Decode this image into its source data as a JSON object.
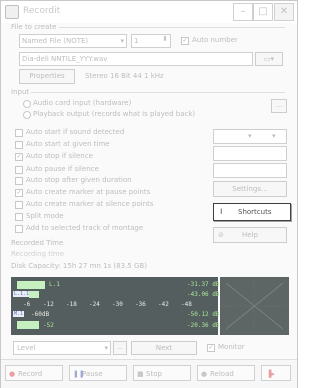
{
  "window": {
    "title": "Recordit",
    "minimize": "–",
    "maximize": "□",
    "close": "✕"
  },
  "file_to_create": {
    "heading": "File to create",
    "name_mode": "Named File (NOTE)",
    "number_value": "1",
    "auto_number_label": "Auto number",
    "auto_number_checked": true,
    "path": "Dia-dell NNTILE_YYY.wav",
    "properties_label": "Properties",
    "format_text": "Stereo 16 Bit 44 1 kHz"
  },
  "input": {
    "heading": "Input",
    "option1": "Audio card input (hardware)",
    "option2": "Playback output (records what is played back)",
    "selected": 1,
    "more_button": "..."
  },
  "options": [
    {
      "label": "Auto start if sound detected",
      "checked": false
    },
    {
      "label": "Auto start at given time",
      "checked": false
    },
    {
      "label": "Auto stop if silence",
      "checked": true
    },
    {
      "label": "Auto pause if silence",
      "checked": false
    },
    {
      "label": "Auto stop after given duration",
      "checked": false
    },
    {
      "label": "Auto create marker at pause points",
      "checked": true
    },
    {
      "label": "Auto create marker at silence points",
      "checked": false
    },
    {
      "label": "Split mode",
      "checked": false
    },
    {
      "label": "Add to selected track of montage",
      "checked": false
    }
  ],
  "side_buttons": {
    "settings": "Settings...",
    "shortcuts": "Shortcuts",
    "help": "Help"
  },
  "recorded_time": {
    "heading": "Recorded Time",
    "value": "Recording time",
    "disk_capacity": "Disk Capacity: 15h 27 mn 1s (83.5 GB)"
  },
  "meter": {
    "row1_left": "L.1",
    "row1_right": "-31.37 dB",
    "row2_tag": "L.1.1",
    "row2_right": "-43.06 dB",
    "scale": [
      "-6",
      "-12",
      "-18",
      "-24",
      "-30",
      "-36",
      "-42",
      "-48"
    ],
    "row3_tag": "M.1",
    "row3_left": "-60dB",
    "row3_right": "-50.12 dB",
    "row4_left": "-52",
    "row4_right": "-20.36 dB",
    "level_fraction": [
      0.17,
      0.06,
      0.0,
      0.12
    ]
  },
  "level_bar": {
    "label": "Level",
    "next_label": "Next",
    "monitor_label": "Monitor",
    "monitor_checked": true
  },
  "transport": {
    "record": "Record",
    "pause": "Pause",
    "stop": "Stop",
    "reload": "Reload"
  }
}
